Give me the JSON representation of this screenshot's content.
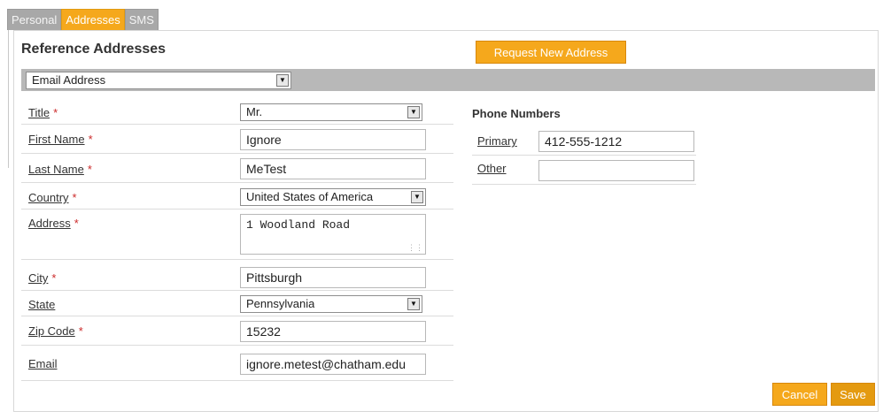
{
  "tabs": [
    {
      "label": "Personal",
      "active": false
    },
    {
      "label": "Addresses",
      "active": true
    },
    {
      "label": "SMS",
      "active": false
    }
  ],
  "section_title": "Reference Addresses",
  "request_button": "Request New Address",
  "address_type": {
    "selected": "Email Address"
  },
  "form": {
    "title": {
      "label": "Title",
      "required": "*",
      "value": "Mr."
    },
    "first_name": {
      "label": "First Name",
      "required": "*",
      "value": "Ignore"
    },
    "last_name": {
      "label": "Last Name",
      "required": "*",
      "value": "MeTest"
    },
    "country": {
      "label": "Country",
      "required": "*",
      "value": "United States of America"
    },
    "address": {
      "label": "Address",
      "required": "*",
      "value": "1 Woodland Road"
    },
    "city": {
      "label": "City",
      "required": "*",
      "value": "Pittsburgh"
    },
    "state": {
      "label": "State",
      "value": "Pennsylvania"
    },
    "zip": {
      "label": "Zip Code",
      "required": "*",
      "value": "15232"
    },
    "email": {
      "label": "Email",
      "value": "ignore.metest@chatham.edu"
    }
  },
  "phones": {
    "title": "Phone Numbers",
    "primary": {
      "label": "Primary",
      "value": "412-555-1212"
    },
    "other": {
      "label": "Other",
      "value": ""
    }
  },
  "buttons": {
    "cancel": "Cancel",
    "save": "Save"
  },
  "colors": {
    "accent": "#f5a81c",
    "tab_inactive": "#a8a8a8",
    "bar": "#b8b8b8",
    "required": "#cc2a2a"
  },
  "icons": {
    "dropdown": "chevron-down-icon",
    "resize": "resize-grip-icon"
  }
}
